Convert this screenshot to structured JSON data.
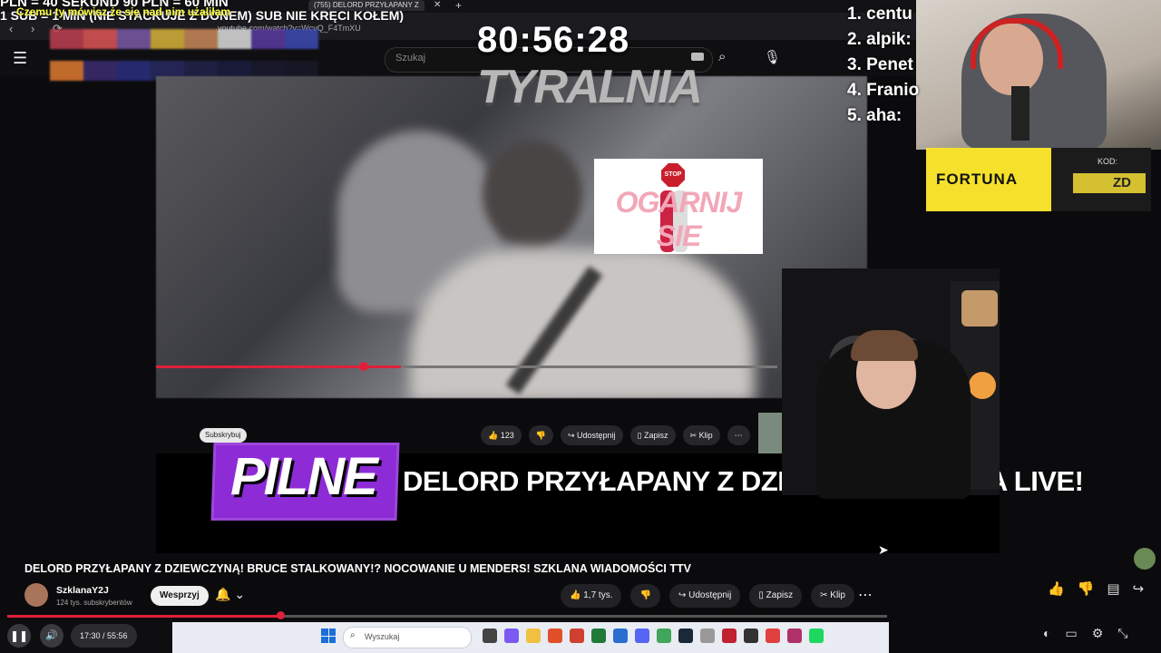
{
  "browser": {
    "tabs": [
      "(755) DELORD PRZYŁAPANY Z"
    ],
    "url": "youtube.com/watch?v=WcvQ_F4TmXU"
  },
  "ticker": {
    "line1": "PLN = 40 SEKUND 90 PLN = 60 MIN",
    "line2": "1 SUB = 1 MIN (NIE STACKUJE Z DONEM) SUB NIE KRĘCI KOŁEM)",
    "overlay_text": "Czemu ty mówisz że się nad nim użaliłam"
  },
  "youtube_header": {
    "search_placeholder": "Szukaj"
  },
  "stream_overlay": {
    "timer": "80:56:28",
    "brand": "TYRALNIA",
    "top5": [
      "1. centu",
      "2. alpik:",
      "3. Penet",
      "4. Franio",
      "5. aha:"
    ]
  },
  "sticker": {
    "stop_label": "STOP",
    "text": "OGARNIJ SIE"
  },
  "embedded_player": {
    "subscribe": "Subskrybuj",
    "likes": "123",
    "share": "Udostępnij",
    "save": "Zapisz",
    "clip": "Klip"
  },
  "breaking_news": {
    "badge": "PILNE",
    "headline": "DELORD PRZYŁAPANY Z DZIEWCZYNĄ POZA LIVE!"
  },
  "sponsor": {
    "name": "FORTUNA",
    "code_label": "KOD:",
    "code": "ZD"
  },
  "video_info": {
    "title": "DELORD PRZYŁAPANY Z DZIEWCZYNĄ! BRUCE STALKOWANY!? NOCOWANIE U MENDERS! SZKLANA WIADOMOŚCI TTV",
    "channel": "SzklanaY2J",
    "subscribers": "124 tys. subskrybentów",
    "support_label": "Wesprzyj",
    "likes": "1,7 tys.",
    "share_label": "Udostępnij",
    "save_label": "Zapisz",
    "clip_label": "Klip"
  },
  "player": {
    "time": "17:30 / 55:56",
    "progress": 0.31
  },
  "taskbar": {
    "search_placeholder": "Wyszukaj"
  }
}
